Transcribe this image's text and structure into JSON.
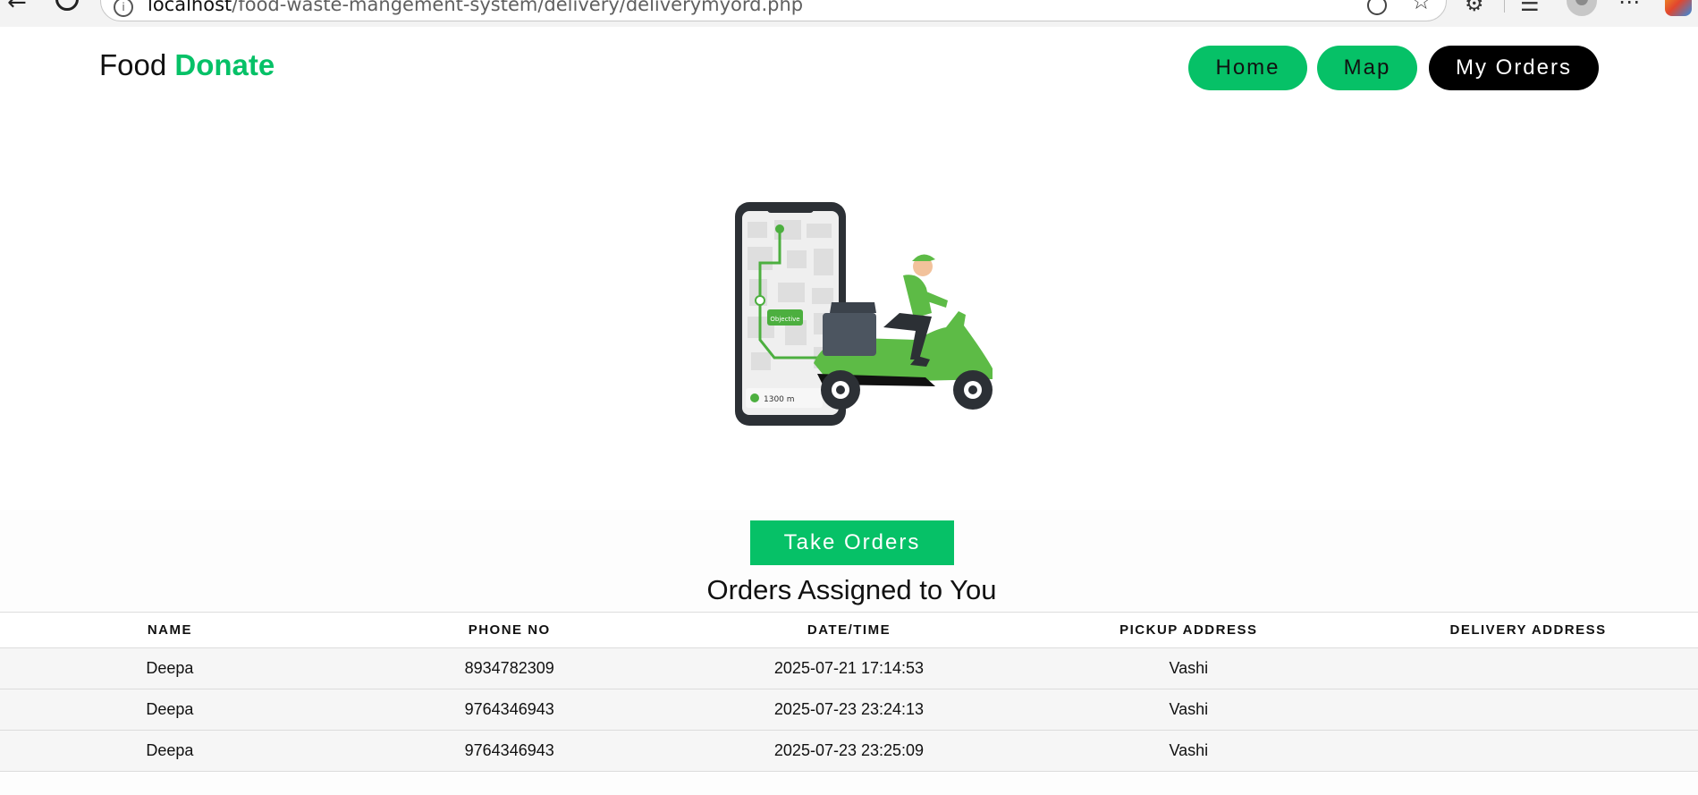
{
  "browser": {
    "url_host": "localhost",
    "url_path": "/food-waste-mangement-system/delivery/deliverymyord.php"
  },
  "brand": {
    "first": "Food",
    "second": "Donate",
    "accent_color": "#06c167"
  },
  "nav": {
    "home": "Home",
    "map": "Map",
    "my_orders": "My Orders"
  },
  "illustration": {
    "map_label": "Objective",
    "distance": "1300 m"
  },
  "take_orders_label": "Take Orders",
  "orders_title": "Orders Assigned to You",
  "table": {
    "headers": [
      "NAME",
      "PHONE NO",
      "DATE/TIME",
      "PICKUP ADDRESS",
      "DELIVERY ADDRESS"
    ],
    "rows": [
      [
        "Deepa",
        "8934782309",
        "2025-07-21 17:14:53",
        "Vashi",
        ""
      ],
      [
        "Deepa",
        "9764346943",
        "2025-07-23 23:24:13",
        "Vashi",
        ""
      ],
      [
        "Deepa",
        "9764346943",
        "2025-07-23 23:25:09",
        "Vashi",
        ""
      ]
    ]
  }
}
